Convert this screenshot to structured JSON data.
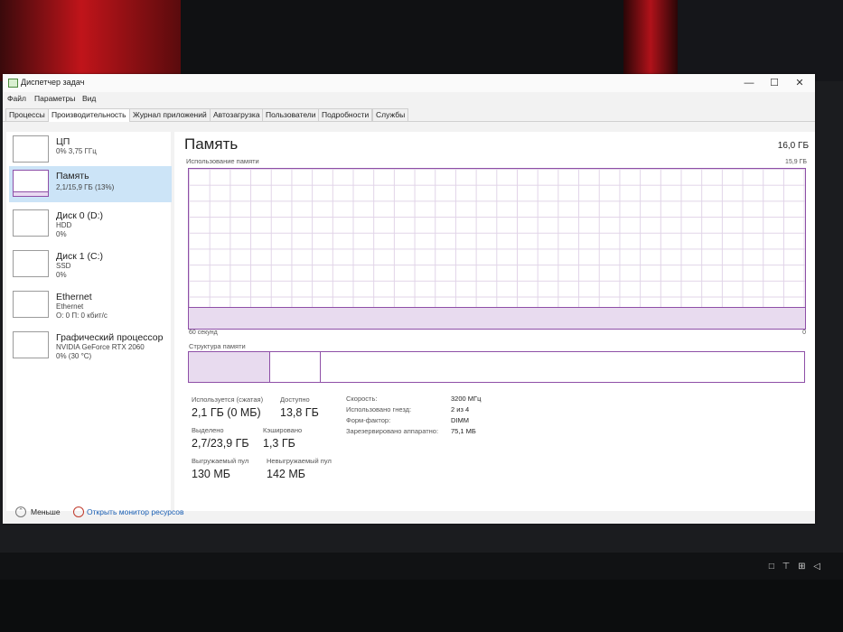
{
  "window": {
    "title": "Диспетчер задач",
    "controls": {
      "minimize": "—",
      "maximize": "☐",
      "close": "✕"
    }
  },
  "menu": [
    "Файл",
    "Параметры",
    "Вид"
  ],
  "tabs": [
    {
      "label": "Процессы"
    },
    {
      "label": "Производительность",
      "active": true
    },
    {
      "label": "Журнал приложений"
    },
    {
      "label": "Автозагрузка"
    },
    {
      "label": "Пользователи"
    },
    {
      "label": "Подробности"
    },
    {
      "label": "Службы"
    }
  ],
  "sidebar": {
    "items": [
      {
        "title": "ЦП",
        "line1": "0% 3,75 ГГц",
        "line2": ""
      },
      {
        "title": "Память",
        "line1": "2,1/15,9 ГБ (13%)",
        "line2": "",
        "selected": true
      },
      {
        "title": "Диск 0 (D:)",
        "line1": "HDD",
        "line2": "0%"
      },
      {
        "title": "Диск 1 (C:)",
        "line1": "SSD",
        "line2": "0%"
      },
      {
        "title": "Ethernet",
        "line1": "Ethernet",
        "line2": "О: 0 П: 0 кбит/с"
      },
      {
        "title": "Графический процессор",
        "line1": "NVIDIA GeForce RTX 2060",
        "line2": "0% (30 °C)"
      }
    ]
  },
  "main": {
    "title": "Память",
    "total": "16,0 ГБ",
    "graph": {
      "label": "Использование памяти",
      "max": "15,9 ГБ",
      "time_left": "60 секунд",
      "time_right": "0",
      "usage_fraction": 0.13
    },
    "structure": {
      "label": "Структура памяти",
      "in_use_fraction": 0.13,
      "modified_fraction": 0.083
    },
    "stats": {
      "in_use_label": "Используется (сжатая)",
      "in_use_value": "2,1 ГБ (0 МБ)",
      "available_label": "Доступно",
      "available_value": "13,8 ГБ",
      "committed_label": "Выделено",
      "committed_value": "2,7/23,9 ГБ",
      "cached_label": "Кэшировано",
      "cached_value": "1,3 ГБ",
      "paged_label": "Выгружаемый пул",
      "paged_value": "130 МБ",
      "nonpaged_label": "Невыгружаемый пул",
      "nonpaged_value": "142 МБ"
    },
    "details": [
      {
        "label": "Скорость:",
        "value": "3200 МГц"
      },
      {
        "label": "Использовано гнезд:",
        "value": "2 из 4"
      },
      {
        "label": "Форм-фактор:",
        "value": "DIMM"
      },
      {
        "label": "Зарезервировано аппаратно:",
        "value": "75,1 МБ"
      }
    ]
  },
  "footer": {
    "less": "Меньше",
    "monitor": "Открыть монитор ресурсов"
  },
  "taskbar": {
    "tray": "□ ⊤ ⊞ ◁"
  },
  "colors": {
    "accent": "#8e4fa7",
    "selection": "#cce4f7",
    "link": "#1a5fb4"
  }
}
